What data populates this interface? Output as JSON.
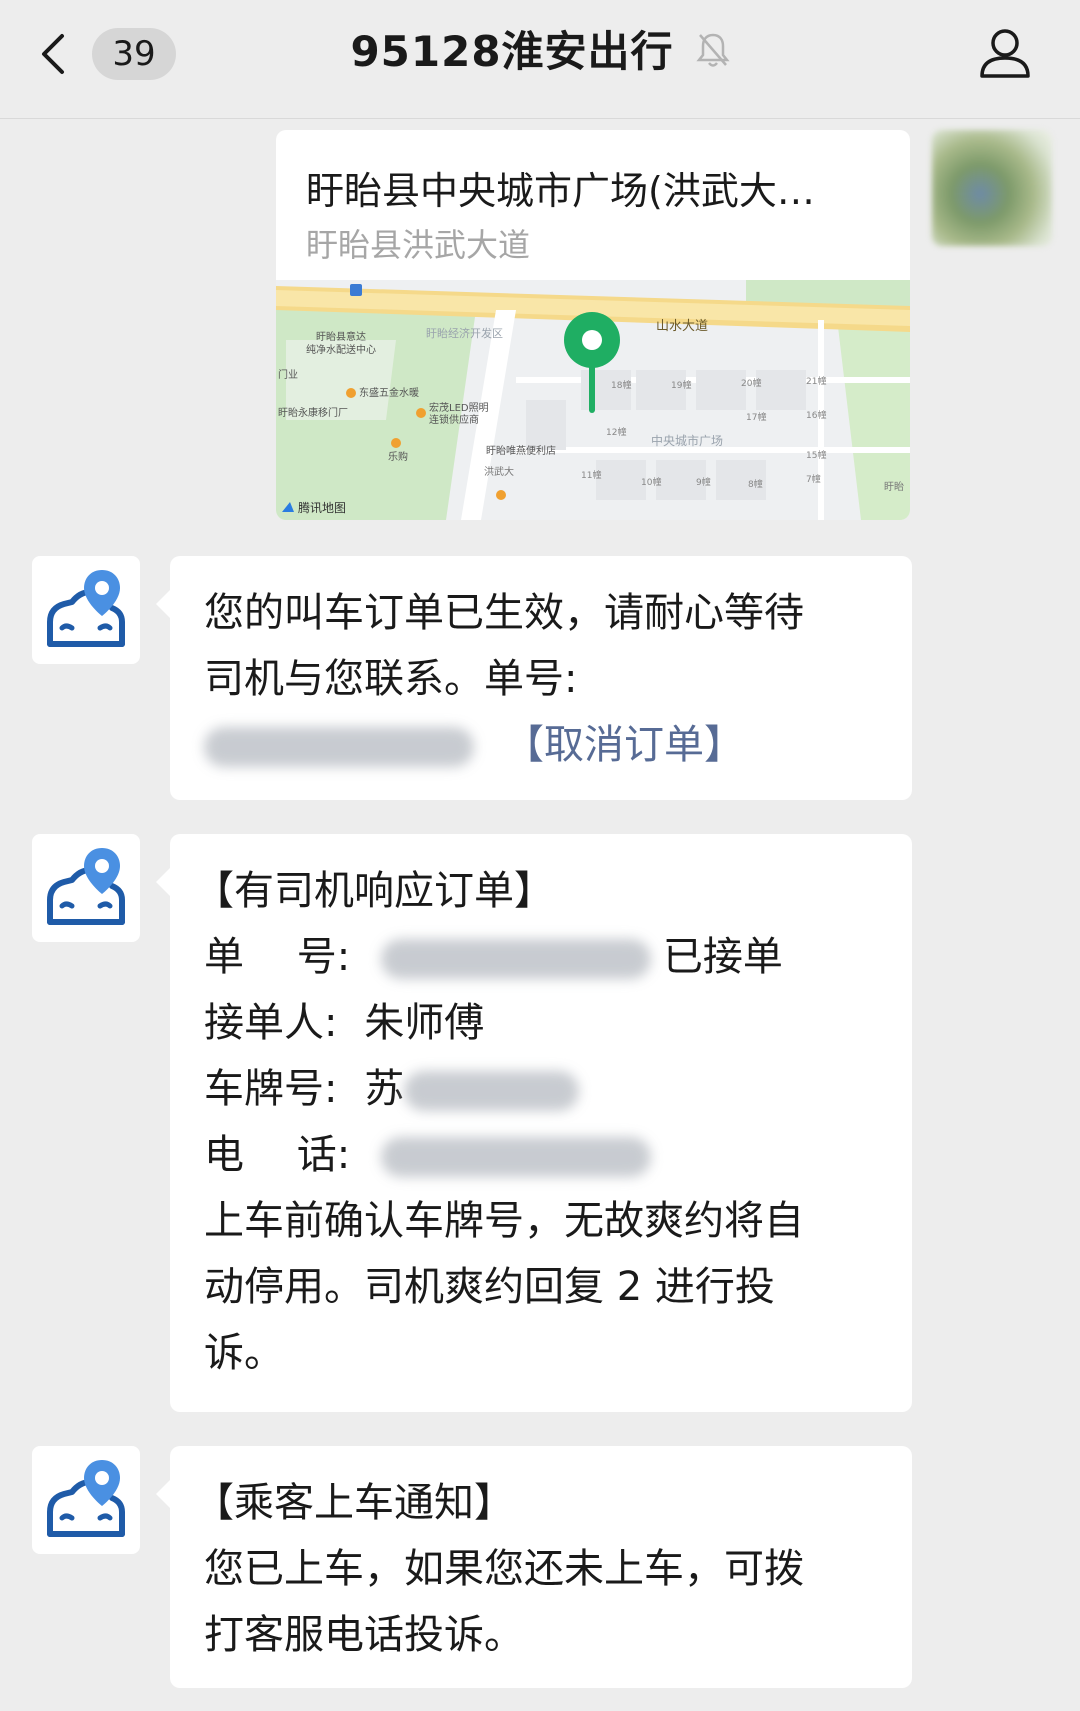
{
  "header": {
    "unread_count": "39",
    "title": "95128淮安出行"
  },
  "location_card": {
    "title": "盱眙县中央城市广场(洪武大…",
    "address": "盱眙县洪武大道",
    "map_labels": {
      "road": "山水大道",
      "zone": "盱眙经济开发区",
      "poi1": "盱眙县意达",
      "poi1b": "纯净水配送中心",
      "poi2": "东盛五金水暖",
      "poi3": "门业",
      "poi4": "盱眙永康移门厂",
      "poi5": "宏茂LED照明",
      "poi5b": "连锁供应商",
      "poi6": "乐购",
      "poi7": "盱眙唯燕便利店",
      "poi8": "中央城市广场",
      "road2": "洪武大",
      "edge": "盱眙",
      "attribution": "腾讯地图",
      "bldg": [
        "18幢",
        "19幢",
        "20幢",
        "21幢",
        "17幢",
        "16幢",
        "12幢",
        "15幢",
        "11幢",
        "10幢",
        "9幢",
        "8幢",
        "7幢"
      ]
    }
  },
  "messages": [
    {
      "line1": "您的叫车订单已生效，请耐心等待",
      "line2": "司机与您联系。单号:",
      "cancel": "【取消订单】"
    },
    {
      "heading": "【有司机响应订单】",
      "order_label": "单　 号:",
      "order_status": "已接单",
      "driver_label": "接单人:",
      "driver_name": "朱师傅",
      "plate_label": "车牌号:",
      "plate_prefix": "苏",
      "phone_label": "电　 话:",
      "notice1": "上车前确认车牌号，无故爽约将自",
      "notice2": "动停用。司机爽约回复 2 进行投",
      "notice3": "诉。"
    },
    {
      "heading": "【乘客上车通知】",
      "line1": "您已上车，如果您还未上车，可拨",
      "line2": "打客服电话投诉。"
    }
  ]
}
